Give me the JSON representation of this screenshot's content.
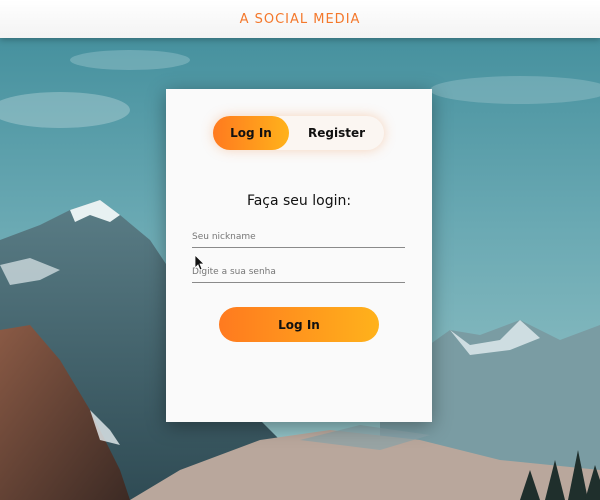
{
  "header": {
    "brand": "A SOCIAL MEDIA"
  },
  "auth_toggle": {
    "login_label": "Log In",
    "register_label": "Register",
    "active": "login"
  },
  "login_form": {
    "title": "Faça seu login:",
    "nickname_placeholder": "Seu nickname",
    "nickname_value": "",
    "password_placeholder": "Digite a sua senha",
    "password_value": "",
    "submit_label": "Log In"
  },
  "colors": {
    "accent_start": "#ff7a1f",
    "accent_end": "#ffb21b",
    "brand": "#f4782b"
  },
  "icons": [
    "mouse-cursor-icon"
  ]
}
